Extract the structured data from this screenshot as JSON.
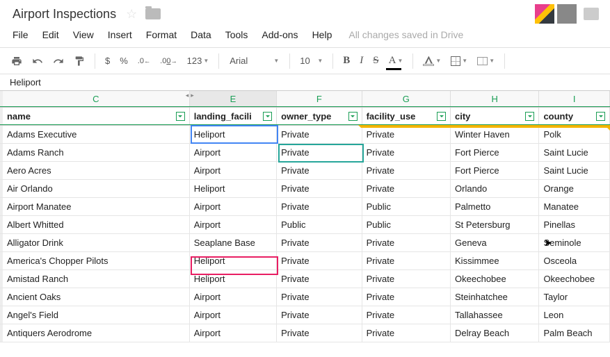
{
  "doc": {
    "title": "Airport Inspections",
    "save_status": "All changes saved in Drive"
  },
  "menu": {
    "file": "File",
    "edit": "Edit",
    "view": "View",
    "insert": "Insert",
    "format": "Format",
    "data": "Data",
    "tools": "Tools",
    "addons": "Add-ons",
    "help": "Help"
  },
  "toolbar": {
    "currency": "$",
    "percent": "%",
    "dec_dec": ".0←",
    "inc_dec": ".00→",
    "num_format": "123",
    "font": "Arial",
    "font_size": "10",
    "bold": "B",
    "italic": "I",
    "strike": "S",
    "text_color": "A"
  },
  "formula": {
    "value": "Heliport"
  },
  "columns": {
    "C": "C",
    "E": "E",
    "F": "F",
    "G": "G",
    "H": "H",
    "I": "I"
  },
  "headers": {
    "name": "name",
    "landing": "landing_facili",
    "owner": "owner_type",
    "facility": "facility_use",
    "city": "city",
    "county": "county"
  },
  "rows": [
    {
      "name": "Adams Executive",
      "landing": "Heliport",
      "owner": "Private",
      "facility": "Private",
      "city": "Winter Haven",
      "county": "Polk"
    },
    {
      "name": "Adams Ranch",
      "landing": "Airport",
      "owner": "Private",
      "facility": "Private",
      "city": "Fort Pierce",
      "county": "Saint Lucie"
    },
    {
      "name": "Aero Acres",
      "landing": "Airport",
      "owner": "Private",
      "facility": "Private",
      "city": "Fort Pierce",
      "county": "Saint Lucie"
    },
    {
      "name": "Air Orlando",
      "landing": "Heliport",
      "owner": "Private",
      "facility": "Private",
      "city": "Orlando",
      "county": "Orange"
    },
    {
      "name": "Airport Manatee",
      "landing": "Airport",
      "owner": "Private",
      "facility": "Public",
      "city": "Palmetto",
      "county": "Manatee"
    },
    {
      "name": "Albert Whitted",
      "landing": "Airport",
      "owner": "Public",
      "facility": "Public",
      "city": "St Petersburg",
      "county": "Pinellas"
    },
    {
      "name": "Alligator Drink",
      "landing": "Seaplane Base",
      "owner": "Private",
      "facility": "Private",
      "city": "Geneva",
      "county": "Seminole"
    },
    {
      "name": "America's Chopper Pilots",
      "landing": "Heliport",
      "owner": "Private",
      "facility": "Private",
      "city": "Kissimmee",
      "county": "Osceola"
    },
    {
      "name": "Amistad Ranch",
      "landing": "Heliport",
      "owner": "Private",
      "facility": "Private",
      "city": "Okeechobee",
      "county": "Okeechobee"
    },
    {
      "name": "Ancient Oaks",
      "landing": "Airport",
      "owner": "Private",
      "facility": "Private",
      "city": "Steinhatchee",
      "county": "Taylor"
    },
    {
      "name": "Angel's Field",
      "landing": "Airport",
      "owner": "Private",
      "facility": "Private",
      "city": "Tallahassee",
      "county": "Leon"
    },
    {
      "name": "Antiquers Aerodrome",
      "landing": "Airport",
      "owner": "Private",
      "facility": "Private",
      "city": "Delray Beach",
      "county": "Palm Beach"
    }
  ]
}
